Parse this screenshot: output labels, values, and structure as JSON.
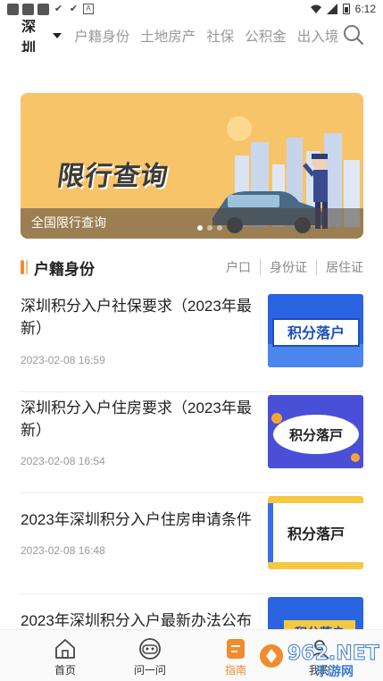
{
  "status_bar": {
    "time": "6:12"
  },
  "top_nav": {
    "city": "深圳",
    "items": [
      "户籍身份",
      "土地房产",
      "社保",
      "公积金",
      "出入境"
    ]
  },
  "banner": {
    "title": "限行查询",
    "caption": "全国限行查询",
    "active_index": 0,
    "dot_count": 3
  },
  "section": {
    "title": "户籍身份",
    "tabs": [
      "户口",
      "身份证",
      "居住证"
    ]
  },
  "articles": [
    {
      "title": "深圳积分入户社保要求（2023年最新）",
      "date": "2023-02-08 16:59",
      "thumb_text": "积分落户"
    },
    {
      "title": "深圳积分入户住房要求（2023年最新）",
      "date": "2023-02-08 16:54",
      "thumb_text": "积分落戸"
    },
    {
      "title": "2023年深圳积分入户住房申请条件",
      "date": "2023-02-08 16:48",
      "thumb_text": "积分落戸"
    },
    {
      "title": "2023年深圳积分入户最新办法公布",
      "date": "",
      "thumb_text": "积分落户"
    }
  ],
  "tabbar": {
    "items": [
      {
        "label": "首页",
        "icon": "home-icon"
      },
      {
        "label": "问一问",
        "icon": "robot-icon"
      },
      {
        "label": "指南",
        "icon": "guide-icon"
      },
      {
        "label": "我的",
        "icon": "user-icon"
      }
    ],
    "active_index": 2
  },
  "watermark": {
    "text": "962.NET",
    "subtext": "乐游网"
  },
  "colors": {
    "accent": "#f28c2b",
    "banner_bg": "#f7c46a",
    "thumb_blue": "#2a64e0"
  }
}
